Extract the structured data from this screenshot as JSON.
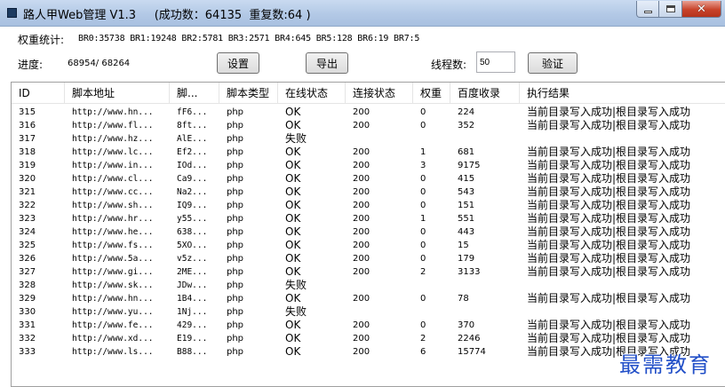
{
  "window": {
    "title": "路人甲Web管理 V1.3     (成功数：64135  重复数:64 )",
    "app_icon": "app-icon",
    "controls": {
      "minimize": "minimize-icon",
      "maximize": "maximize-icon",
      "close": "close-icon",
      "close_glyph": "✕"
    }
  },
  "stats": {
    "label": "权重统计:",
    "values": "BR0:35738 BR1:19248 BR2:5781 BR3:2571 BR4:645 BR5:128 BR6:19 BR7:5"
  },
  "progress": {
    "label": "进度:",
    "value": "68954/ 68264"
  },
  "buttons": {
    "settings": "设置",
    "export": "导出",
    "verify": "验证"
  },
  "threads": {
    "label": "线程数:",
    "value": "50"
  },
  "table": {
    "columns": [
      "ID",
      "脚本地址",
      "脚...",
      "脚本类型",
      "在线状态",
      "连接状态",
      "权重",
      "百度收录",
      "执行结果"
    ],
    "rows": [
      {
        "id": "315",
        "url": "http://www.hn...",
        "script": "fF6...",
        "type": "php",
        "online": "OK",
        "conn": "200",
        "weight": "0",
        "baidu": "224",
        "result": "当前目录写入成功|根目录写入成功"
      },
      {
        "id": "316",
        "url": "http://www.fl...",
        "script": "8ft...",
        "type": "php",
        "online": "OK",
        "conn": "200",
        "weight": "0",
        "baidu": "352",
        "result": "当前目录写入成功|根目录写入成功"
      },
      {
        "id": "317",
        "url": "http://www.hz...",
        "script": "AlE...",
        "type": "php",
        "online": "失败",
        "conn": "",
        "weight": "",
        "baidu": "",
        "result": ""
      },
      {
        "id": "318",
        "url": "http://www.lc...",
        "script": "Ef2...",
        "type": "php",
        "online": "OK",
        "conn": "200",
        "weight": "1",
        "baidu": "681",
        "result": "当前目录写入成功|根目录写入成功"
      },
      {
        "id": "319",
        "url": "http://www.in...",
        "script": "IOd...",
        "type": "php",
        "online": "OK",
        "conn": "200",
        "weight": "3",
        "baidu": "9175",
        "result": "当前目录写入成功|根目录写入成功"
      },
      {
        "id": "320",
        "url": "http://www.cl...",
        "script": "Ca9...",
        "type": "php",
        "online": "OK",
        "conn": "200",
        "weight": "0",
        "baidu": "415",
        "result": "当前目录写入成功|根目录写入成功"
      },
      {
        "id": "321",
        "url": "http://www.cc...",
        "script": "Na2...",
        "type": "php",
        "online": "OK",
        "conn": "200",
        "weight": "0",
        "baidu": "543",
        "result": "当前目录写入成功|根目录写入成功"
      },
      {
        "id": "322",
        "url": "http://www.sh...",
        "script": "IQ9...",
        "type": "php",
        "online": "OK",
        "conn": "200",
        "weight": "0",
        "baidu": "151",
        "result": "当前目录写入成功|根目录写入成功"
      },
      {
        "id": "323",
        "url": "http://www.hr...",
        "script": "y55...",
        "type": "php",
        "online": "OK",
        "conn": "200",
        "weight": "1",
        "baidu": "551",
        "result": "当前目录写入成功|根目录写入成功"
      },
      {
        "id": "324",
        "url": "http://www.he...",
        "script": "638...",
        "type": "php",
        "online": "OK",
        "conn": "200",
        "weight": "0",
        "baidu": "443",
        "result": "当前目录写入成功|根目录写入成功"
      },
      {
        "id": "325",
        "url": "http://www.fs...",
        "script": "5XO...",
        "type": "php",
        "online": "OK",
        "conn": "200",
        "weight": "0",
        "baidu": "15",
        "result": "当前目录写入成功|根目录写入成功"
      },
      {
        "id": "326",
        "url": "http://www.5a...",
        "script": "v5z...",
        "type": "php",
        "online": "OK",
        "conn": "200",
        "weight": "0",
        "baidu": "179",
        "result": "当前目录写入成功|根目录写入成功"
      },
      {
        "id": "327",
        "url": "http://www.gi...",
        "script": "2ME...",
        "type": "php",
        "online": "OK",
        "conn": "200",
        "weight": "2",
        "baidu": "3133",
        "result": "当前目录写入成功|根目录写入成功"
      },
      {
        "id": "328",
        "url": "http://www.sk...",
        "script": "JDw...",
        "type": "php",
        "online": "失败",
        "conn": "",
        "weight": "",
        "baidu": "",
        "result": ""
      },
      {
        "id": "329",
        "url": "http://www.hn...",
        "script": "1B4...",
        "type": "php",
        "online": "OK",
        "conn": "200",
        "weight": "0",
        "baidu": "78",
        "result": "当前目录写入成功|根目录写入成功"
      },
      {
        "id": "330",
        "url": "http://www.yu...",
        "script": "1Nj...",
        "type": "php",
        "online": "失败",
        "conn": "",
        "weight": "",
        "baidu": "",
        "result": ""
      },
      {
        "id": "331",
        "url": "http://www.fe...",
        "script": "429...",
        "type": "php",
        "online": "OK",
        "conn": "200",
        "weight": "0",
        "baidu": "370",
        "result": "当前目录写入成功|根目录写入成功"
      },
      {
        "id": "332",
        "url": "http://www.xd...",
        "script": "E19...",
        "type": "php",
        "online": "OK",
        "conn": "200",
        "weight": "2",
        "baidu": "2246",
        "result": "当前目录写入成功|根目录写入成功"
      },
      {
        "id": "333",
        "url": "http://www.ls...",
        "script": "B88...",
        "type": "php",
        "online": "OK",
        "conn": "200",
        "weight": "6",
        "baidu": "15774",
        "result": "当前目录写入成功|根目录写入成功"
      }
    ]
  },
  "watermark": "最需教育",
  "colors": {
    "titlebar": "#b9cde8",
    "close_button": "#c8432a",
    "watermark": "#2350c8"
  }
}
